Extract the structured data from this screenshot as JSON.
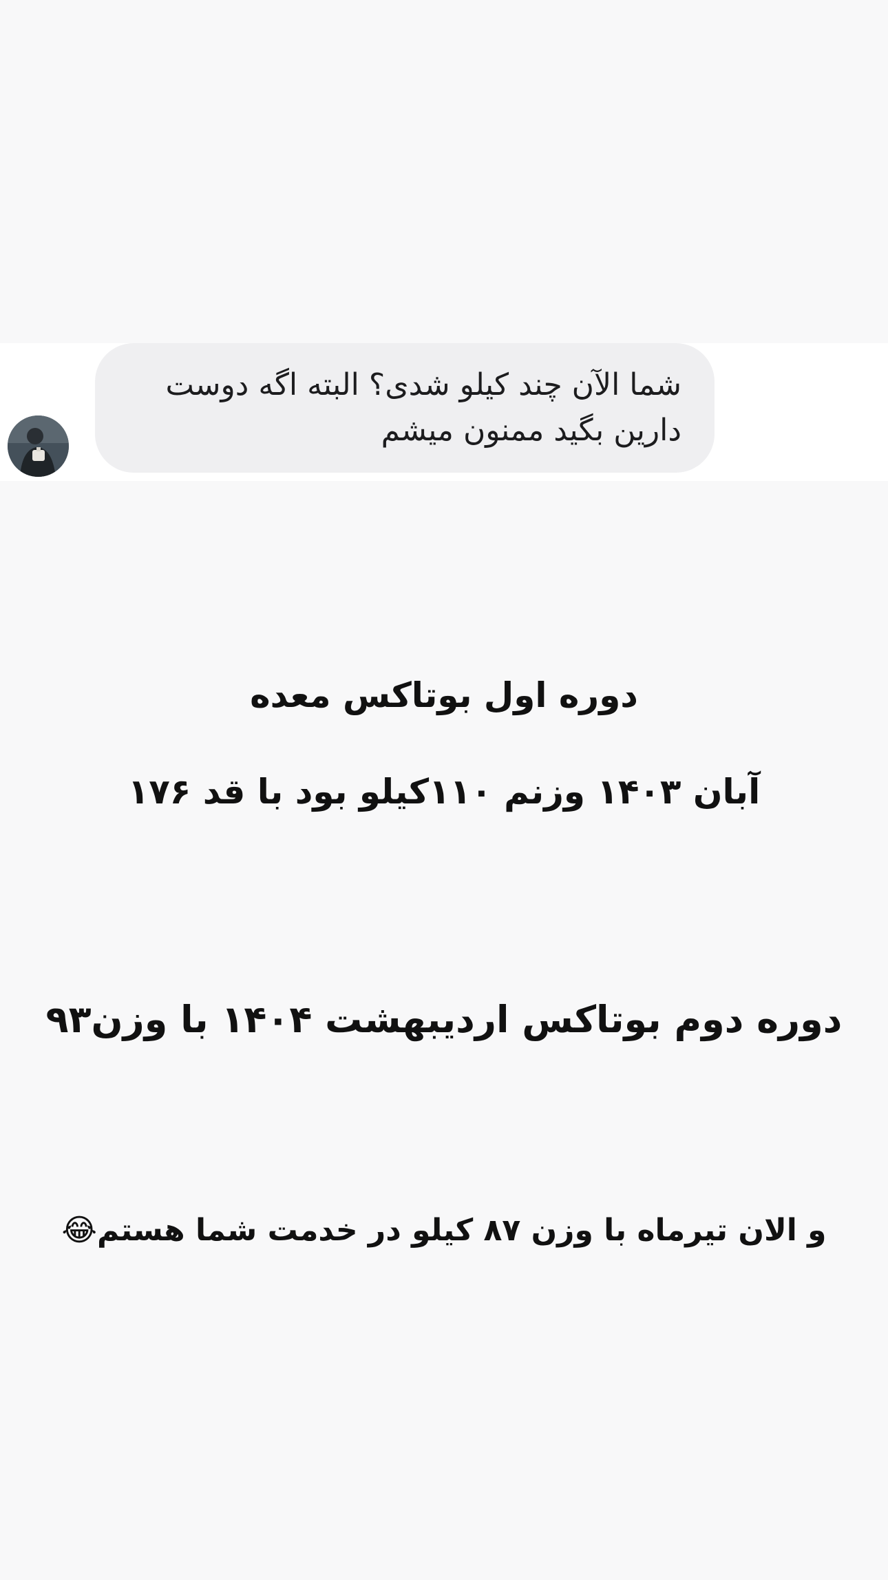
{
  "reply": {
    "message": "شما الآن چند کیلو شدی؟ البته اگه دوست دارین بگید ممنون میشم"
  },
  "story": {
    "line1": "دوره اول بوتاکس معده",
    "line2": "آبان ۱۴۰۳ وزنم ۱۱۰کیلو بود با قد ۱۷۶",
    "line3": "دوره دوم  بوتاکس اردیبهشت ۱۴۰۴ با وزن۹۳",
    "line4": "و الان تیرماه با وزن ۸۷ کیلو در خدمت شما هستم😂"
  },
  "icons": {
    "avatar": "user-avatar-photo"
  },
  "colors": {
    "background": "#f8f8f9",
    "bubble": "#efeff1",
    "text": "#111111"
  }
}
